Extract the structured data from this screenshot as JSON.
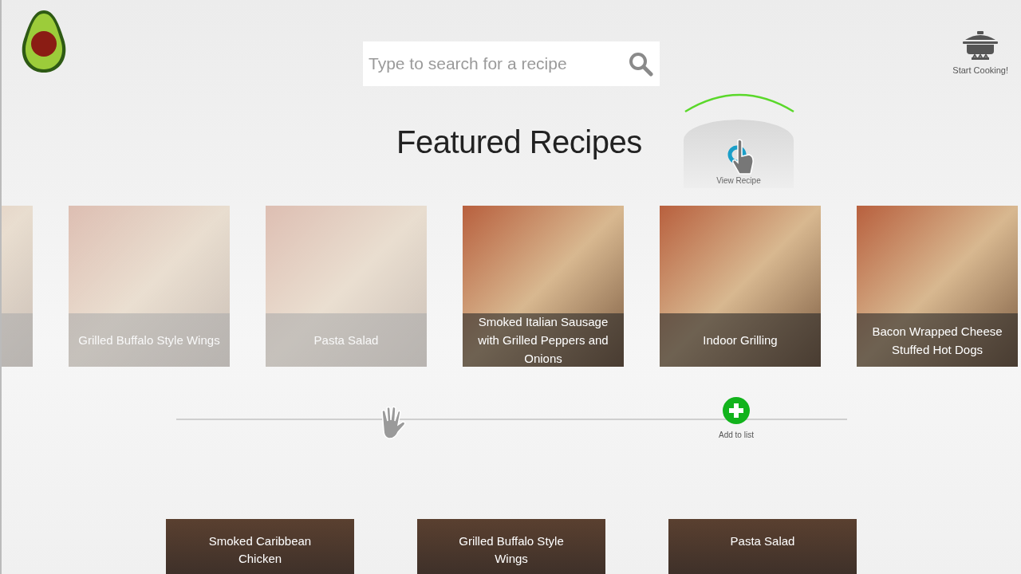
{
  "search": {
    "placeholder": "Type to search for a recipe"
  },
  "start_cooking": {
    "label": "Start Cooking!"
  },
  "heading": "Featured Recipes",
  "radial_menu": {
    "label": "View Recipe"
  },
  "carousel": [
    {
      "faded": true
    },
    {
      "title": "Grilled Buffalo Style Wings",
      "faded": true
    },
    {
      "title": "Pasta Salad",
      "faded": true
    },
    {
      "title": "Smoked Italian Sausage with Grilled Peppers and Onions",
      "faded": false
    },
    {
      "title": "Indoor Grilling",
      "faded": false
    },
    {
      "title": "Bacon Wrapped Cheese Stuffed Hot Dogs",
      "faded": false
    }
  ],
  "add_to_list": {
    "label": "Add to list"
  },
  "more_recipes": [
    {
      "title": "Smoked Caribbean Chicken"
    },
    {
      "title": "Grilled Buffalo Style Wings"
    },
    {
      "title": "Pasta Salad"
    }
  ]
}
